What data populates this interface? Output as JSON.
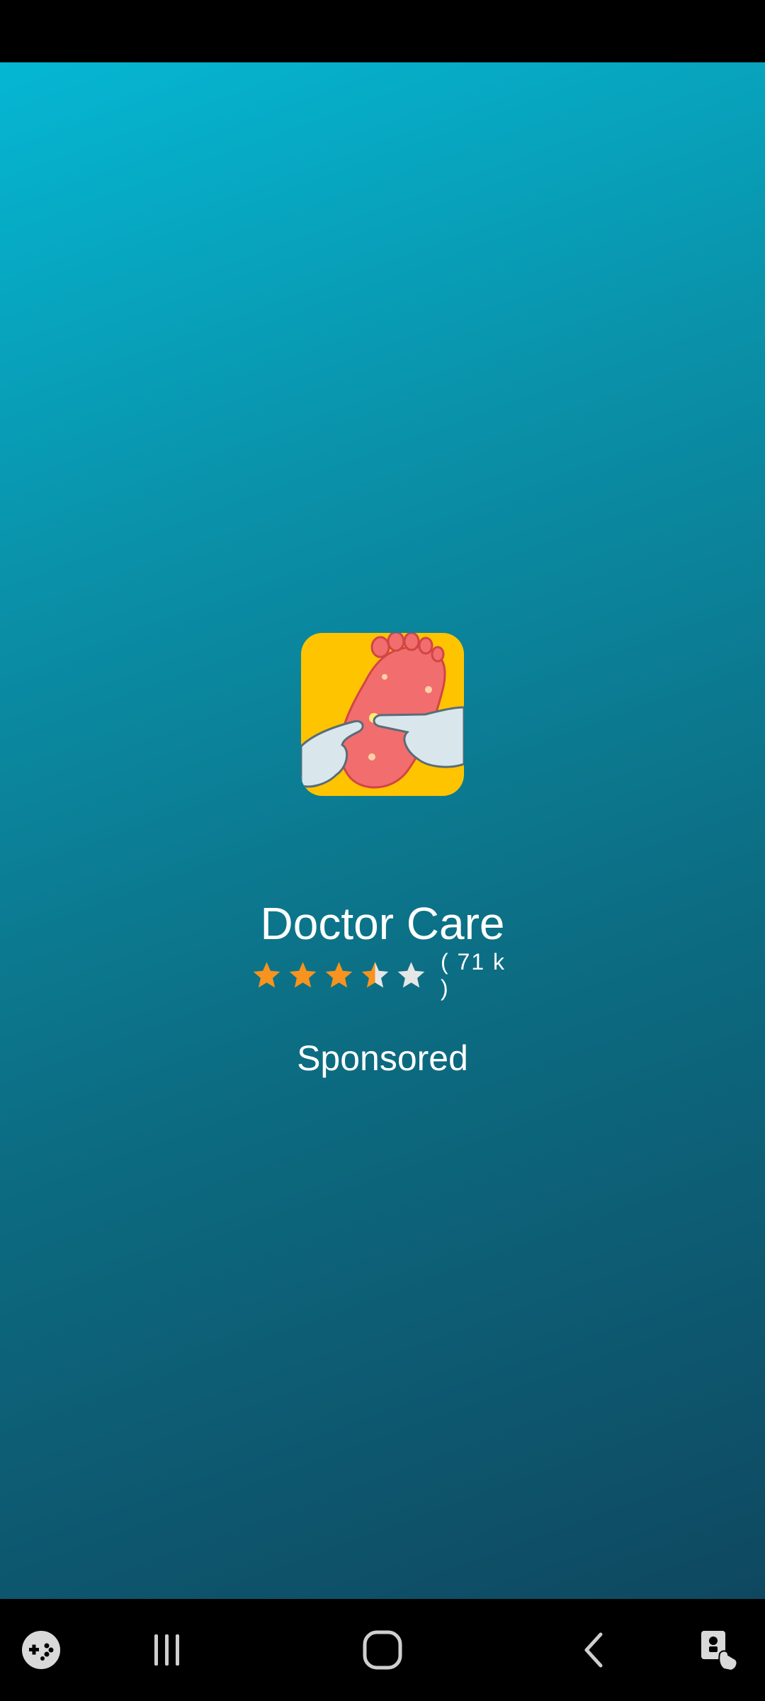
{
  "app": {
    "title": "Doctor Care",
    "rating_stars": 3.5,
    "rating_max": 5,
    "rating_count": "( 71 k )",
    "sponsored_label": "Sponsored",
    "icon": "foot-app-icon"
  },
  "colors": {
    "gradient_start": "#05b7d3",
    "gradient_end": "#0e4860",
    "star_filled": "#f7931e",
    "star_empty": "#e6e6e6",
    "icon_bg": "#ffc400"
  },
  "navigation_bar": {
    "items": [
      "game-launcher-icon",
      "recent-apps-icon",
      "home-icon",
      "back-icon",
      "accessibility-icon"
    ]
  }
}
